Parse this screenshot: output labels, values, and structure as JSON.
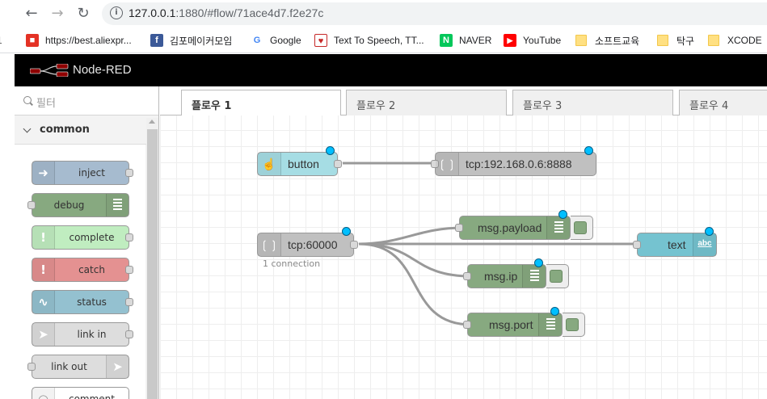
{
  "browser": {
    "back_icon": "arrow-left-icon",
    "forward_icon": "arrow-right-icon",
    "reload_icon": "reload-icon",
    "url_host": "127.0.0.1",
    "url_path": ":1880/#flow/71ace4d7.f2e27c",
    "bookmarks": [
      {
        "label": "https://best.aliexpr...",
        "icon": "aliexpress-icon"
      },
      {
        "label": "김포메이커모임",
        "icon": "facebook-icon"
      },
      {
        "label": "Google",
        "icon": "google-icon"
      },
      {
        "label": "Text To Speech, TT...",
        "icon": "tts-icon"
      },
      {
        "label": "NAVER",
        "icon": "naver-icon"
      },
      {
        "label": "YouTube",
        "icon": "youtube-icon"
      },
      {
        "label": "소프트교육",
        "icon": "folder-icon"
      },
      {
        "label": "탁구",
        "icon": "folder-icon"
      },
      {
        "label": "XCODE",
        "icon": "folder-icon"
      }
    ]
  },
  "app": {
    "title": "Node-RED"
  },
  "palette": {
    "filter_placeholder": "필터",
    "category": "common",
    "nodes": [
      {
        "label": "inject",
        "color": "#a6bbcf"
      },
      {
        "label": "debug",
        "color": "#87a980"
      },
      {
        "label": "complete",
        "color": "#c0edc0"
      },
      {
        "label": "catch",
        "color": "#e49191"
      },
      {
        "label": "status",
        "color": "#94c1d0"
      },
      {
        "label": "link in",
        "color": "#dddddd"
      },
      {
        "label": "link out",
        "color": "#dddddd"
      },
      {
        "label": "comment",
        "color": "#ffffff"
      }
    ]
  },
  "tabs": [
    {
      "label": "플로우 1",
      "active": true
    },
    {
      "label": "플로우 2",
      "active": false
    },
    {
      "label": "플로우 3",
      "active": false
    },
    {
      "label": "플로우 4",
      "active": false
    }
  ],
  "flow": {
    "nodes": {
      "button": {
        "label": "button",
        "color": "#a6dde4"
      },
      "tcp_out": {
        "label": "tcp:192.168.0.6:8888",
        "color": "#c0c0c0"
      },
      "tcp_in": {
        "label": "tcp:60000",
        "color": "#c0c0c0",
        "status": "1 connection"
      },
      "debug_payload": {
        "label": "msg.payload",
        "color": "#87a980"
      },
      "text": {
        "label": "text",
        "color": "#75c3d0",
        "badge": "abc"
      },
      "debug_ip": {
        "label": "msg.ip",
        "color": "#87a980"
      },
      "debug_port": {
        "label": "msg.port",
        "color": "#87a980"
      }
    }
  }
}
